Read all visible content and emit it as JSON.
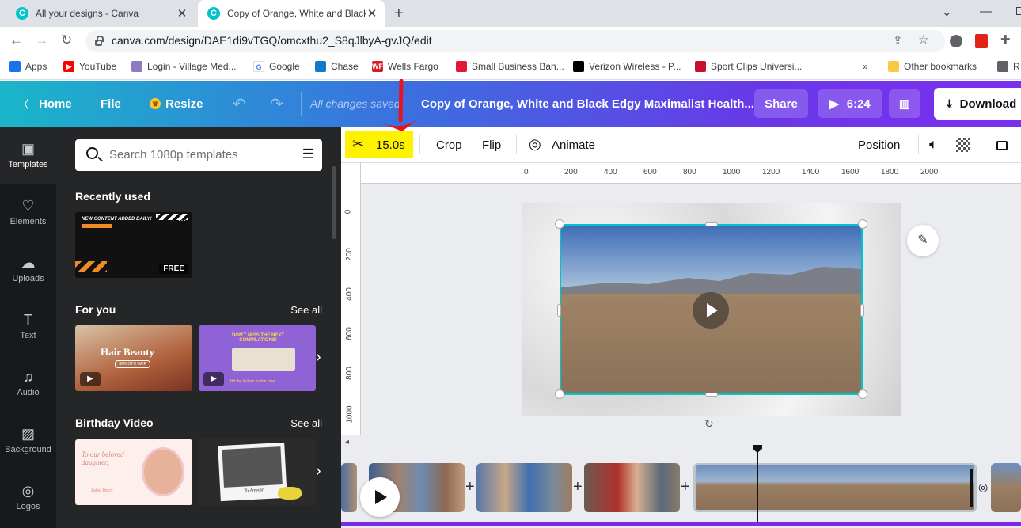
{
  "browser": {
    "tabs": [
      {
        "title": "All your designs - Canva",
        "favicon": "C"
      },
      {
        "title": "Copy of Orange, White and Black",
        "favicon": "C"
      }
    ],
    "url": "canva.com/design/DAE1di9vTGQ/omcxthu2_S8qJlbyA-gvJQ/edit",
    "bookmarks": [
      "Apps",
      "YouTube",
      "Login - Village Med...",
      "Google",
      "Chase",
      "Wells Fargo",
      "Small Business Ban...",
      "Verizon Wireless - P...",
      "Sport Clips Universi..."
    ],
    "bookmarks_more": "»",
    "other_bookmarks": "Other bookmarks",
    "reading_list": "R"
  },
  "header": {
    "home": "Home",
    "file": "File",
    "resize": "Resize",
    "status": "All changes saved",
    "title": "Copy of Orange, White and Black Edgy Maximalist Health...",
    "share": "Share",
    "duration": "6:24",
    "download": "Download"
  },
  "rail": [
    "Templates",
    "Elements",
    "Uploads",
    "Text",
    "Audio",
    "Background",
    "Logos"
  ],
  "panel": {
    "search_placeholder": "Search 1080p templates",
    "recent_label": "Recently used",
    "recent_thumb": {
      "headline": "NEW CONTENT ADDED DAILY!",
      "badge": "FREE",
      "menu": "···"
    },
    "foryou_label": "For you",
    "foryou_see_all": "See all",
    "foryou_thumbs": [
      {
        "text": "Hair Beauty",
        "sub": "SMOOTH HAIR"
      },
      {
        "text": "DON'T MISS THE NEXT COMPILATIONS!",
        "sub": "Hit the Follow button now!"
      }
    ],
    "birthday_label": "Birthday Video",
    "birthday_see_all": "See all",
    "birthday_thumbs": [
      {
        "text": "To our beloved daughter,",
        "sub": "Zahra Darcy"
      },
      {
        "text": "To Anwesh"
      }
    ]
  },
  "toolbar": {
    "trim": "15.0s",
    "crop": "Crop",
    "flip": "Flip",
    "animate": "Animate",
    "position": "Position"
  },
  "ruler": {
    "h": [
      "0",
      "200",
      "400",
      "600",
      "800",
      "1000",
      "1200",
      "1400",
      "1600",
      "1800",
      "2000"
    ],
    "v": [
      "0",
      "200",
      "400",
      "600",
      "800",
      "1000"
    ]
  },
  "colors": {
    "accent": "#00c4cc",
    "purple": "#7d2ae8",
    "highlight": "#fff200",
    "annotation": "#e8141b"
  }
}
